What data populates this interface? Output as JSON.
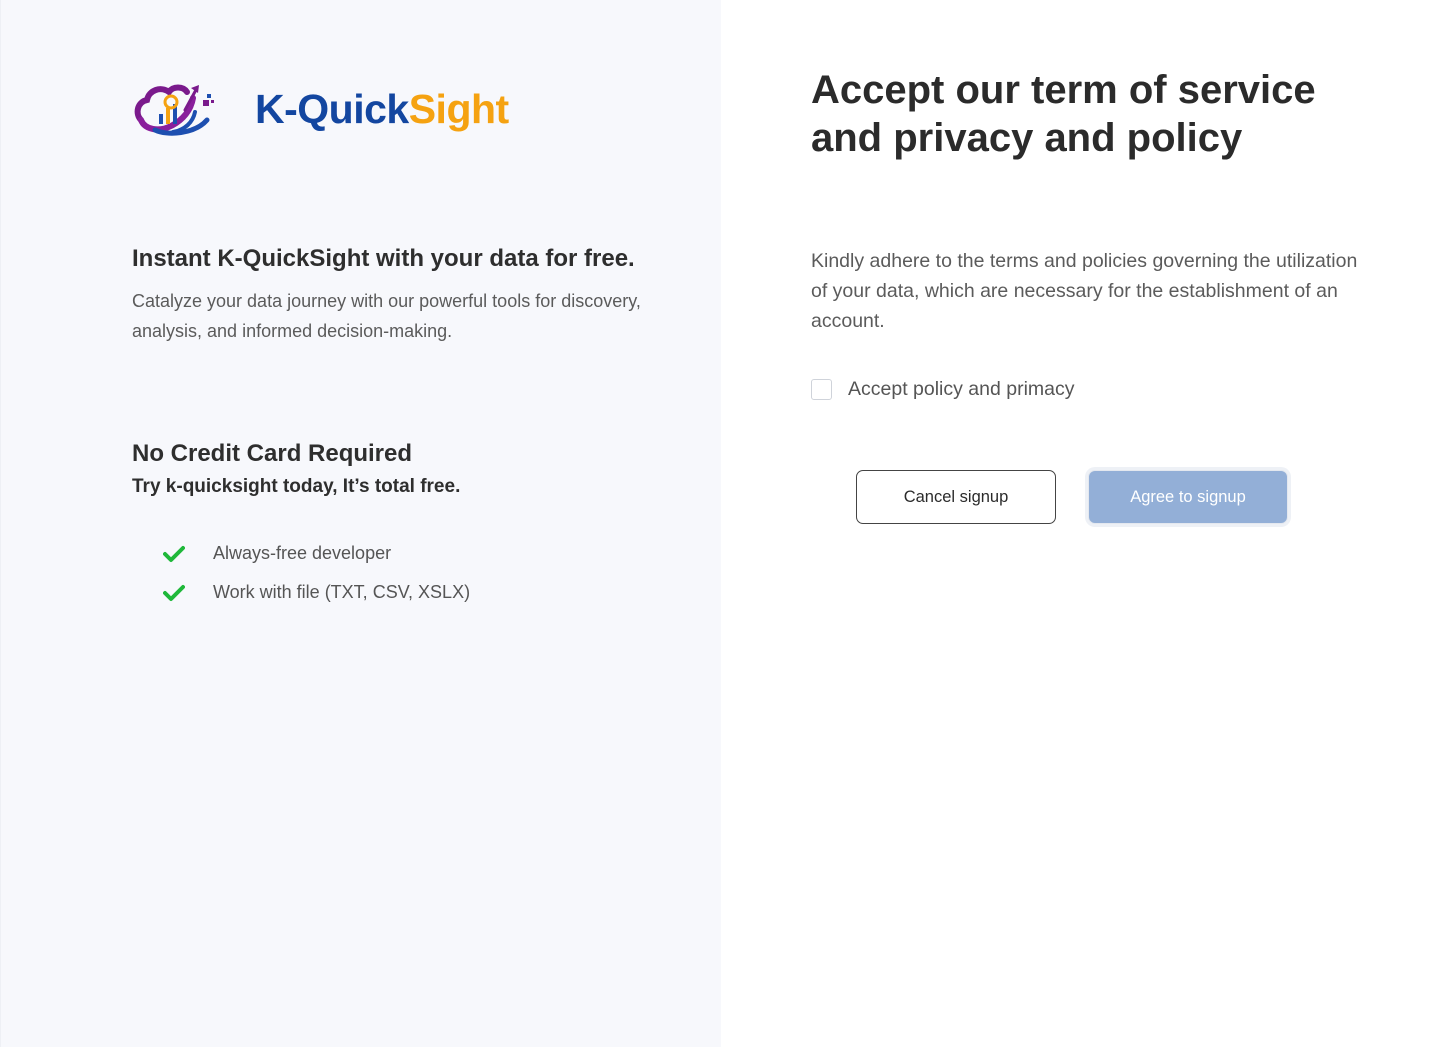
{
  "brand": {
    "name_part1": "K-Quick",
    "name_part2": "Sight",
    "primary_color": "#1346a0",
    "accent_color": "#f5a211",
    "logo_icon": "cloud-growth-logo-icon"
  },
  "intro": {
    "title": "Instant K-QuickSight with your data for free.",
    "description": "Catalyze your data journey with our powerful tools for discovery, analysis, and informed decision-making."
  },
  "promo": {
    "title": "No Credit Card Required",
    "subtitle": "Try k-quicksight today, It’s total free.",
    "features": [
      {
        "icon": "check-icon",
        "label": "Always-free developer"
      },
      {
        "icon": "check-icon",
        "label": "Work with file (TXT, CSV, XSLX)"
      }
    ],
    "check_color": "#1fb83a"
  },
  "terms": {
    "title": "Accept our term of service and privacy and policy",
    "description": "Kindly adhere to the terms and policies governing the utilization of your data, which are necessary for the establishment of an account.",
    "checkbox_label": "Accept policy and primacy",
    "checkbox_checked": false
  },
  "actions": {
    "cancel_label": "Cancel signup",
    "agree_label": "Agree to signup",
    "agree_disabled_color": "#93afd7"
  }
}
